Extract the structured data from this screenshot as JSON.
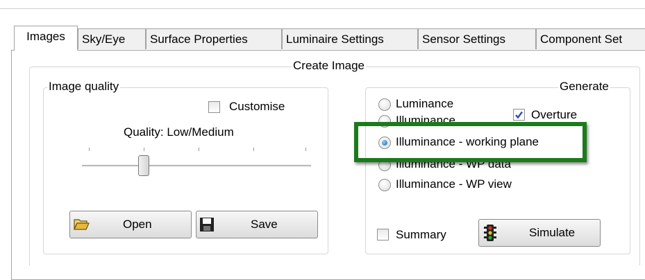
{
  "tabs": [
    {
      "label": "Images",
      "active": true
    },
    {
      "label": "Sky/Eye"
    },
    {
      "label": "Surface Properties"
    },
    {
      "label": "Luminaire Settings"
    },
    {
      "label": "Sensor Settings"
    },
    {
      "label": "Component Set"
    }
  ],
  "create_image": {
    "title": "Create Image",
    "image_quality": {
      "title": "Image quality",
      "customise_label": "Customise",
      "customise_checked": false,
      "quality_label": "Quality: Low/Medium",
      "slider_value": 0.25,
      "open_label": "Open",
      "save_label": "Save"
    },
    "generate": {
      "title": "Generate",
      "options": [
        {
          "label": "Luminance",
          "checked": false
        },
        {
          "label": "Illuminance",
          "checked": false
        },
        {
          "label": "Illuminance - working plane",
          "checked": true
        },
        {
          "label": "Illuminance - WP data",
          "checked": false
        },
        {
          "label": "Illuminance - WP view",
          "checked": false
        }
      ],
      "overture_label": "Overture",
      "overture_checked": true,
      "summary_label": "Summary",
      "summary_checked": false,
      "simulate_label": "Simulate"
    }
  },
  "highlight_color": "#1b7a1b"
}
